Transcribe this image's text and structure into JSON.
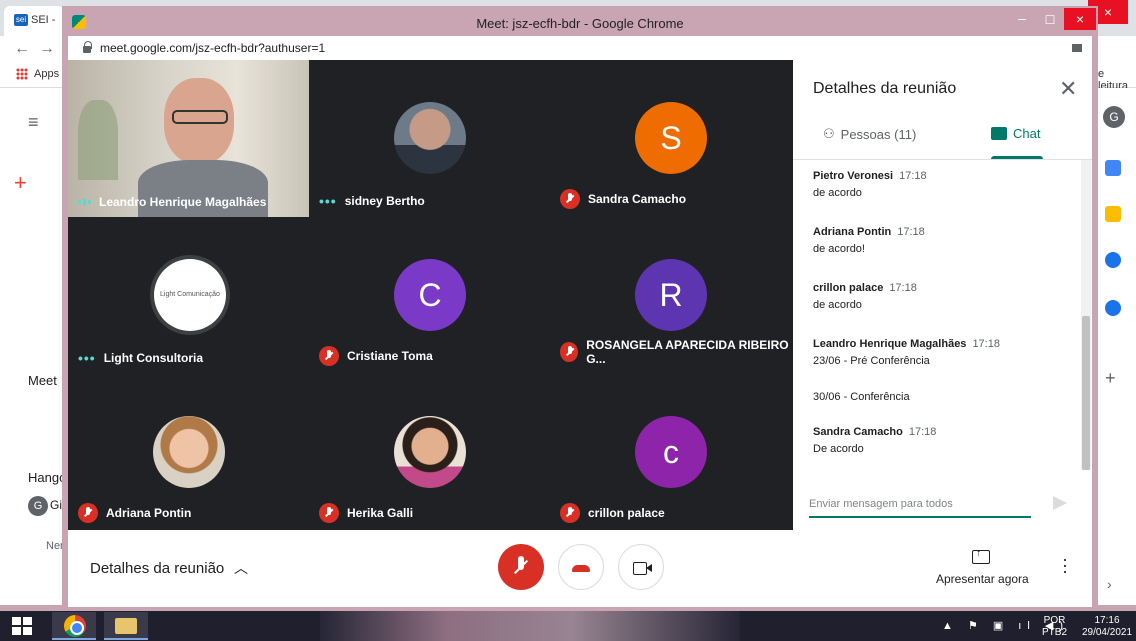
{
  "background": {
    "tab_label": "SEI -",
    "bookmarks_apps": "Apps",
    "bookmark_right": "e leitura",
    "left_items": [
      "Meet",
      "Hango",
      "Ner"
    ],
    "avatar_letter": "G",
    "gi_label": "Gi"
  },
  "window": {
    "title": "Meet: jsz-ecfh-bdr - Google Chrome",
    "url": "meet.google.com/jsz-ecfh-bdr?authuser=1"
  },
  "participants": [
    {
      "name": "Leandro Henrique Magalhães",
      "status": "speaking",
      "kind": "video"
    },
    {
      "name": "sidney Bertho",
      "status": "dots",
      "kind": "photo"
    },
    {
      "name": "Sandra Camacho",
      "status": "muted",
      "kind": "letter",
      "letter": "S",
      "color": "#ef6c00"
    },
    {
      "name": "Light Consultoria",
      "status": "dots",
      "kind": "logo",
      "logo_text": "Light Comunicação"
    },
    {
      "name": "Cristiane Toma",
      "status": "muted",
      "kind": "letter",
      "letter": "C",
      "color": "#7b39c7"
    },
    {
      "name": "ROSANGELA APARECIDA RIBEIRO G...",
      "status": "muted",
      "kind": "letter",
      "letter": "R",
      "color": "#5e35b1"
    },
    {
      "name": "Adriana Pontin",
      "status": "muted",
      "kind": "photo"
    },
    {
      "name": "Herika Galli",
      "status": "muted",
      "kind": "photo"
    },
    {
      "name": "crillon palace",
      "status": "muted",
      "kind": "letter",
      "letter": "c",
      "color": "#8e24aa"
    }
  ],
  "panel": {
    "title": "Detalhes da reunião",
    "tab_people": "Pessoas (11)",
    "tab_chat": "Chat",
    "messages": [
      {
        "who": "Pietro Veronesi",
        "time": "17:18",
        "text": "de acordo"
      },
      {
        "who": "Adriana Pontin",
        "time": "17:18",
        "text": "de acordo!"
      },
      {
        "who": "crillon palace",
        "time": "17:18",
        "text": "de acordo"
      },
      {
        "who": "Leandro Henrique Magalhães",
        "time": "17:18",
        "text": "23/06 - Pré Conferência"
      },
      {
        "who": "",
        "time": "",
        "text": "30/06 - Conferência"
      },
      {
        "who": "Sandra Camacho",
        "time": "17:18",
        "text": "De acordo"
      }
    ],
    "input_placeholder": "Enviar mensagem para todos"
  },
  "bottombar": {
    "details_label": "Detalhes da reunião",
    "present_label": "Apresentar agora"
  },
  "taskbar": {
    "lang_top": "POR",
    "lang_bottom": "PTB2",
    "time": "17:16",
    "date": "29/04/2021"
  },
  "colors": {
    "accent": "#00796b",
    "mute_red": "#d93025",
    "tile_bg": "#202124"
  }
}
